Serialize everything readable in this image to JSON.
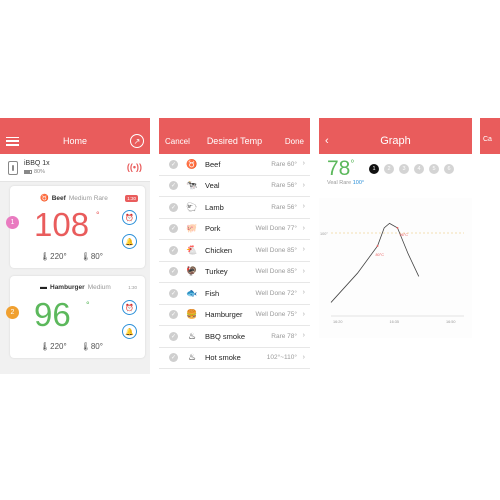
{
  "colors": {
    "accent": "#e95c5c",
    "blue": "#2a8fd8",
    "green": "#5cb85c",
    "red": "#e95c5c"
  },
  "home": {
    "title": "Home",
    "device": {
      "name": "iBBQ 1x",
      "battery": "80%"
    },
    "cards": [
      {
        "probe": "1",
        "food": "Beef",
        "doneness": "Medium Rare",
        "temp": "108",
        "ambient": "220°",
        "target": "80°",
        "badge": "1:30",
        "color": "#e95c5c",
        "probe_color": "#e97bc0"
      },
      {
        "probe": "2",
        "food": "Hamburger",
        "doneness": "Medium",
        "temp": "96",
        "ambient": "220°",
        "target": "80°",
        "badge": "1:30",
        "color": "#5cb85c",
        "probe_color": "#f0a030"
      }
    ]
  },
  "desired": {
    "cancel": "Cancel",
    "title": "Desired Temp",
    "done": "Done",
    "foods": [
      {
        "name": "Beef",
        "level": "Rare  60°",
        "icon": "bull-icon"
      },
      {
        "name": "Veal",
        "level": "Rare  56°",
        "icon": "cow-icon"
      },
      {
        "name": "Lamb",
        "level": "Rare  56°",
        "icon": "lamb-icon"
      },
      {
        "name": "Pork",
        "level": "Well Done 77°",
        "icon": "pig-icon"
      },
      {
        "name": "Chicken",
        "level": "Well Done 85°",
        "icon": "chicken-icon"
      },
      {
        "name": "Turkey",
        "level": "Well Done 85°",
        "icon": "turkey-icon"
      },
      {
        "name": "Fish",
        "level": "Well Done 72°",
        "icon": "fish-icon"
      },
      {
        "name": "Hamburger",
        "level": "Well Done 75°",
        "icon": "hamburger-icon"
      },
      {
        "name": "BBQ smoke",
        "level": "Rare  78°",
        "icon": "smoke-icon"
      },
      {
        "name": "Hot smoke",
        "level": "102°~110°",
        "icon": "hot-smoke-icon"
      }
    ]
  },
  "graph": {
    "title": "Graph",
    "temp": "78",
    "probes": [
      "1",
      "2",
      "3",
      "4",
      "5",
      "6"
    ],
    "food": "Veal",
    "doneness": "Rare",
    "target": "100°",
    "chart_data": {
      "type": "line",
      "x_ticks": [
        "16:20",
        "16:35",
        "16:50"
      ],
      "y_ref_label": "100°",
      "points": [
        [
          0,
          0.12
        ],
        [
          0.2,
          0.38
        ],
        [
          0.35,
          0.62
        ],
        [
          0.4,
          0.78
        ],
        [
          0.44,
          0.82
        ],
        [
          0.5,
          0.78
        ],
        [
          0.58,
          0.55
        ],
        [
          0.66,
          0.35
        ]
      ],
      "annotations": [
        "80°C",
        "96°C"
      ]
    }
  },
  "next": {
    "cancel": "Ca"
  }
}
